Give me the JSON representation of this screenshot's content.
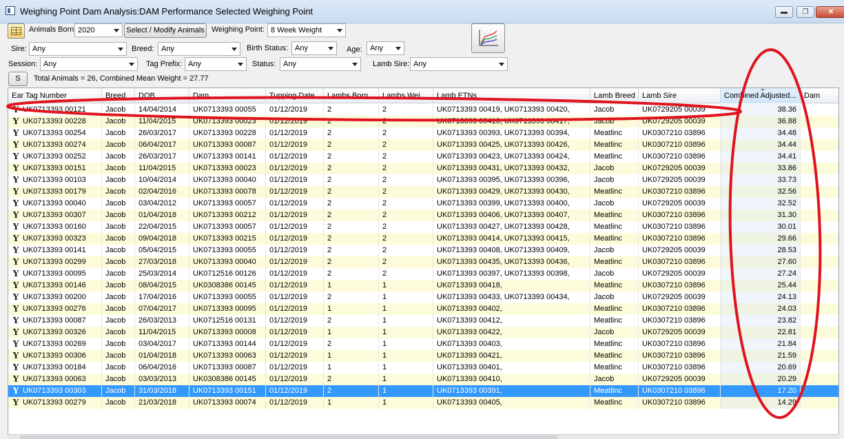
{
  "window": {
    "title": "Weighing Point Dam Analysis:DAM Performance Selected Weighing Point",
    "minimize_icon": "minimize-icon",
    "restore_icon": "restore-icon",
    "close_icon": "close-icon",
    "minimize_glyph": "▬",
    "restore_glyph": "❐",
    "close_glyph": "✕"
  },
  "filters": {
    "animals_born_label": "Animals Born:",
    "animals_born_value": "2020",
    "select_modify_label": "Select / Modify Animals",
    "weighing_point_label": "Weighing Point:",
    "weighing_point_value": "8 Week Weight",
    "sire_label": "Sire:",
    "sire_value": "Any",
    "breed_label": "Breed:",
    "breed_value": "Any",
    "birth_status_label": "Birth Status:",
    "birth_status_value": "Any",
    "age_label": "Age:",
    "age_value": "Any",
    "session_label": "Session:",
    "session_value": "Any",
    "tag_prefix_label": "Tag Prefix:",
    "tag_prefix_value": "Any",
    "status_label": "Status:",
    "status_value": "Any",
    "lamb_sire_label": "Lamb Sire:",
    "lamb_sire_value": "Any",
    "s_button_label": "S",
    "summary": "Total Animals = 26, Combined Mean Weight = 27.77"
  },
  "table": {
    "columns": [
      "Ear Tag Number",
      "Breed",
      "DOB",
      "Dam",
      "Tupping Date",
      "Lambs Born",
      "Lambs Wei...",
      "Lamb ETNs",
      "Lamb Breed",
      "Lamb Sire",
      "Combined Adjusted...",
      "Dam"
    ],
    "sorted_column": 10,
    "rows": [
      [
        "UK0713393 00121",
        "Jacob",
        "14/04/2014",
        "UK0713393 00055",
        "01/12/2019",
        "2",
        "2",
        "UK0713393 00419, UK0713393 00420,",
        "Jacob",
        "UK0729205 00039",
        "38.36",
        ""
      ],
      [
        "UK0713393 00228",
        "Jacob",
        "11/04/2015",
        "UK0713393 00023",
        "01/12/2019",
        "2",
        "2",
        "UK0713393 00416, UK0713393 00417,",
        "Jacob",
        "UK0729205 00039",
        "36.88",
        ""
      ],
      [
        "UK0713393 00254",
        "Jacob",
        "26/03/2017",
        "UK0713393 00228",
        "01/12/2019",
        "2",
        "2",
        "UK0713393 00393, UK0713393 00394,",
        "Meatlinc",
        "UK0307210 03896",
        "34.48",
        ""
      ],
      [
        "UK0713393 00274",
        "Jacob",
        "06/04/2017",
        "UK0713393 00087",
        "01/12/2019",
        "2",
        "2",
        "UK0713393 00425, UK0713393 00426,",
        "Meatlinc",
        "UK0307210 03896",
        "34.44",
        ""
      ],
      [
        "UK0713393 00252",
        "Jacob",
        "26/03/2017",
        "UK0713393 00141",
        "01/12/2019",
        "2",
        "2",
        "UK0713393 00423, UK0713393 00424,",
        "Meatlinc",
        "UK0307210 03896",
        "34.41",
        ""
      ],
      [
        "UK0713393 00151",
        "Jacob",
        "11/04/2015",
        "UK0713393 00023",
        "01/12/2019",
        "2",
        "2",
        "UK0713393 00431, UK0713393 00432,",
        "Jacob",
        "UK0729205 00039",
        "33.86",
        ""
      ],
      [
        "UK0713393 00103",
        "Jacob",
        "10/04/2014",
        "UK0713393 00040",
        "01/12/2019",
        "2",
        "2",
        "UK0713393 00395, UK0713393 00396,",
        "Jacob",
        "UK0729205 00039",
        "33.73",
        ""
      ],
      [
        "UK0713393 00179",
        "Jacob",
        "02/04/2016",
        "UK0713393 00078",
        "01/12/2019",
        "2",
        "2",
        "UK0713393 00429, UK0713393 00430,",
        "Meatlinc",
        "UK0307210 03896",
        "32.56",
        ""
      ],
      [
        "UK0713393 00040",
        "Jacob",
        "03/04/2012",
        "UK0713393 00057",
        "01/12/2019",
        "2",
        "2",
        "UK0713393 00399, UK0713393 00400,",
        "Jacob",
        "UK0729205 00039",
        "32.52",
        ""
      ],
      [
        "UK0713393 00307",
        "Jacob",
        "01/04/2018",
        "UK0713393 00212",
        "01/12/2019",
        "2",
        "2",
        "UK0713393 00406, UK0713393 00407,",
        "Meatlinc",
        "UK0307210 03896",
        "31.30",
        ""
      ],
      [
        "UK0713393 00160",
        "Jacob",
        "22/04/2015",
        "UK0713393 00057",
        "01/12/2019",
        "2",
        "2",
        "UK0713393 00427, UK0713393 00428,",
        "Meatlinc",
        "UK0307210 03896",
        "30.01",
        ""
      ],
      [
        "UK0713393 00323",
        "Jacob",
        "09/04/2018",
        "UK0713393 00215",
        "01/12/2019",
        "2",
        "2",
        "UK0713393 00414, UK0713393 00415,",
        "Meatlinc",
        "UK0307210 03896",
        "29.66",
        ""
      ],
      [
        "UK0713393 00141",
        "Jacob",
        "05/04/2015",
        "UK0713393 00055",
        "01/12/2019",
        "2",
        "2",
        "UK0713393 00408, UK0713393 00409,",
        "Jacob",
        "UK0729205 00039",
        "28.53",
        ""
      ],
      [
        "UK0713393 00299",
        "Jacob",
        "27/03/2018",
        "UK0713393 00040",
        "01/12/2019",
        "2",
        "2",
        "UK0713393 00435, UK0713393 00436,",
        "Meatlinc",
        "UK0307210 03896",
        "27.60",
        ""
      ],
      [
        "UK0713393 00095",
        "Jacob",
        "25/03/2014",
        "UK0712516 00126",
        "01/12/2019",
        "2",
        "2",
        "UK0713393 00397, UK0713393 00398,",
        "Jacob",
        "UK0729205 00039",
        "27.24",
        ""
      ],
      [
        "UK0713393 00146",
        "Jacob",
        "08/04/2015",
        "UK0308386 00145",
        "01/12/2019",
        "1",
        "1",
        "UK0713393 00418,",
        "Meatlinc",
        "UK0307210 03896",
        "25.44",
        ""
      ],
      [
        "UK0713393 00200",
        "Jacob",
        "17/04/2016",
        "UK0713393 00055",
        "01/12/2019",
        "2",
        "1",
        "UK0713393 00433, UK0713393 00434,",
        "Jacob",
        "UK0729205 00039",
        "24.13",
        ""
      ],
      [
        "UK0713393 00276",
        "Jacob",
        "07/04/2017",
        "UK0713393 00095",
        "01/12/2019",
        "1",
        "1",
        "UK0713393 00402,",
        "Meatlinc",
        "UK0307210 03896",
        "24.03",
        ""
      ],
      [
        "UK0713393 00087",
        "Jacob",
        "26/03/2013",
        "UK0712516 00131",
        "01/12/2019",
        "2",
        "1",
        "UK0713393 00412,",
        "Meatlinc",
        "UK0307210 03896",
        "23.82",
        ""
      ],
      [
        "UK0713393 00326",
        "Jacob",
        "11/04/2015",
        "UK0713393 00008",
        "01/12/2019",
        "1",
        "1",
        "UK0713393 00422,",
        "Jacob",
        "UK0729205 00039",
        "22.81",
        ""
      ],
      [
        "UK0713393 00269",
        "Jacob",
        "03/04/2017",
        "UK0713393 00144",
        "01/12/2019",
        "2",
        "1",
        "UK0713393 00403,",
        "Meatlinc",
        "UK0307210 03896",
        "21.84",
        ""
      ],
      [
        "UK0713393 00306",
        "Jacob",
        "01/04/2018",
        "UK0713393 00063",
        "01/12/2019",
        "1",
        "1",
        "UK0713393 00421,",
        "Meatlinc",
        "UK0307210 03896",
        "21.59",
        ""
      ],
      [
        "UK0713393 00184",
        "Jacob",
        "06/04/2016",
        "UK0713393 00087",
        "01/12/2019",
        "1",
        "1",
        "UK0713393 00401,",
        "Meatlinc",
        "UK0307210 03896",
        "20.69",
        ""
      ],
      [
        "UK0713393 00063",
        "Jacob",
        "03/03/2013",
        "UK0308386 00145",
        "01/12/2019",
        "2",
        "1",
        "UK0713393 00410,",
        "Jacob",
        "UK0729205 00039",
        "20.29",
        ""
      ],
      [
        "UK0713393 00303",
        "Jacob",
        "31/03/2018",
        "UK0713393 00151",
        "01/12/2019",
        "2",
        "1",
        "UK0713393 00391,",
        "Meatlinc",
        "UK0307210 03896",
        "17.20",
        ""
      ],
      [
        "UK0713393 00279",
        "Jacob",
        "21/03/2018",
        "UK0713393 00074",
        "01/12/2019",
        "1",
        "1",
        "UK0713393 00405,",
        "Meatlinc",
        "UK0307210 03896",
        "14.29",
        ""
      ]
    ],
    "selected_row": 24,
    "row_icon": "ewe-icon",
    "row_glyph": "Y"
  },
  "colors": {
    "alt_row": "#fdfcda",
    "selected_row": "#3399ff",
    "annotation": "#e0141e"
  }
}
